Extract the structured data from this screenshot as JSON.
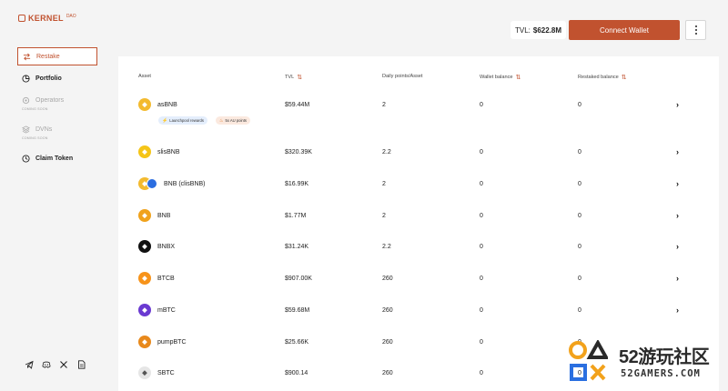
{
  "header": {
    "logo_text": "KERNEL",
    "logo_sup": "DAO",
    "tvl_label": "TVL:",
    "tvl_value": "$622.8M",
    "connect_label": "Connect Wallet"
  },
  "sidebar": {
    "items": [
      {
        "label": "Restake",
        "icon": "swap-icon",
        "state": "active"
      },
      {
        "label": "Portfolio",
        "icon": "pie-chart-icon",
        "state": "normal"
      },
      {
        "label": "Operators",
        "icon": "gear-icon",
        "state": "disabled",
        "badge": "COMING SOON"
      },
      {
        "label": "DVNs",
        "icon": "layers-icon",
        "state": "disabled",
        "badge": "COMING SOON"
      },
      {
        "label": "Claim Token",
        "icon": "clock-icon",
        "state": "normal"
      }
    ],
    "socials": [
      "telegram-icon",
      "discord-icon",
      "x-icon",
      "document-icon"
    ]
  },
  "table": {
    "headers": {
      "asset": "Asset",
      "tvl": "TVL",
      "points": "Daily points/Asset",
      "wallet": "Wallet balance",
      "restaked": "Restaked balance"
    },
    "rows": [
      {
        "name": "asBNB",
        "tvl": "$59.44M",
        "points": "2",
        "wallet": "0",
        "restaked": "0",
        "color": "#f3ba2f",
        "tags": [
          {
            "label": "Launchpool rewards",
            "icon": "lightning-icon"
          },
          {
            "label": "5x AU points",
            "icon": "flame-icon"
          }
        ]
      },
      {
        "name": "slisBNB",
        "tvl": "$320.39K",
        "points": "2.2",
        "wallet": "0",
        "restaked": "0",
        "color": "#f5c518"
      },
      {
        "name": "BNB (clisBNB)",
        "tvl": "$16.99K",
        "points": "2",
        "wallet": "0",
        "restaked": "0",
        "color": "#f3ba2f",
        "second_color": "#2b6de0"
      },
      {
        "name": "BNB",
        "tvl": "$1.77M",
        "points": "2",
        "wallet": "0",
        "restaked": "0",
        "color": "#f0a21c"
      },
      {
        "name": "BNBX",
        "tvl": "$31.24K",
        "points": "2.2",
        "wallet": "0",
        "restaked": "0",
        "color": "#111111"
      },
      {
        "name": "BTCB",
        "tvl": "$907.00K",
        "points": "260",
        "wallet": "0",
        "restaked": "0",
        "color": "#f7931a"
      },
      {
        "name": "mBTC",
        "tvl": "$59.68M",
        "points": "260",
        "wallet": "0",
        "restaked": "0",
        "color": "#6a3ad1"
      },
      {
        "name": "pumpBTC",
        "tvl": "$25.66K",
        "points": "260",
        "wallet": "0",
        "restaked": "0",
        "color": "#e8891c"
      },
      {
        "name": "SBTC",
        "tvl": "$900.14",
        "points": "260",
        "wallet": "0",
        "restaked": "0",
        "color": "#e6e6e6"
      }
    ]
  },
  "watermark": {
    "title": "52游玩社区",
    "subtitle": "52GAMERS.COM"
  }
}
